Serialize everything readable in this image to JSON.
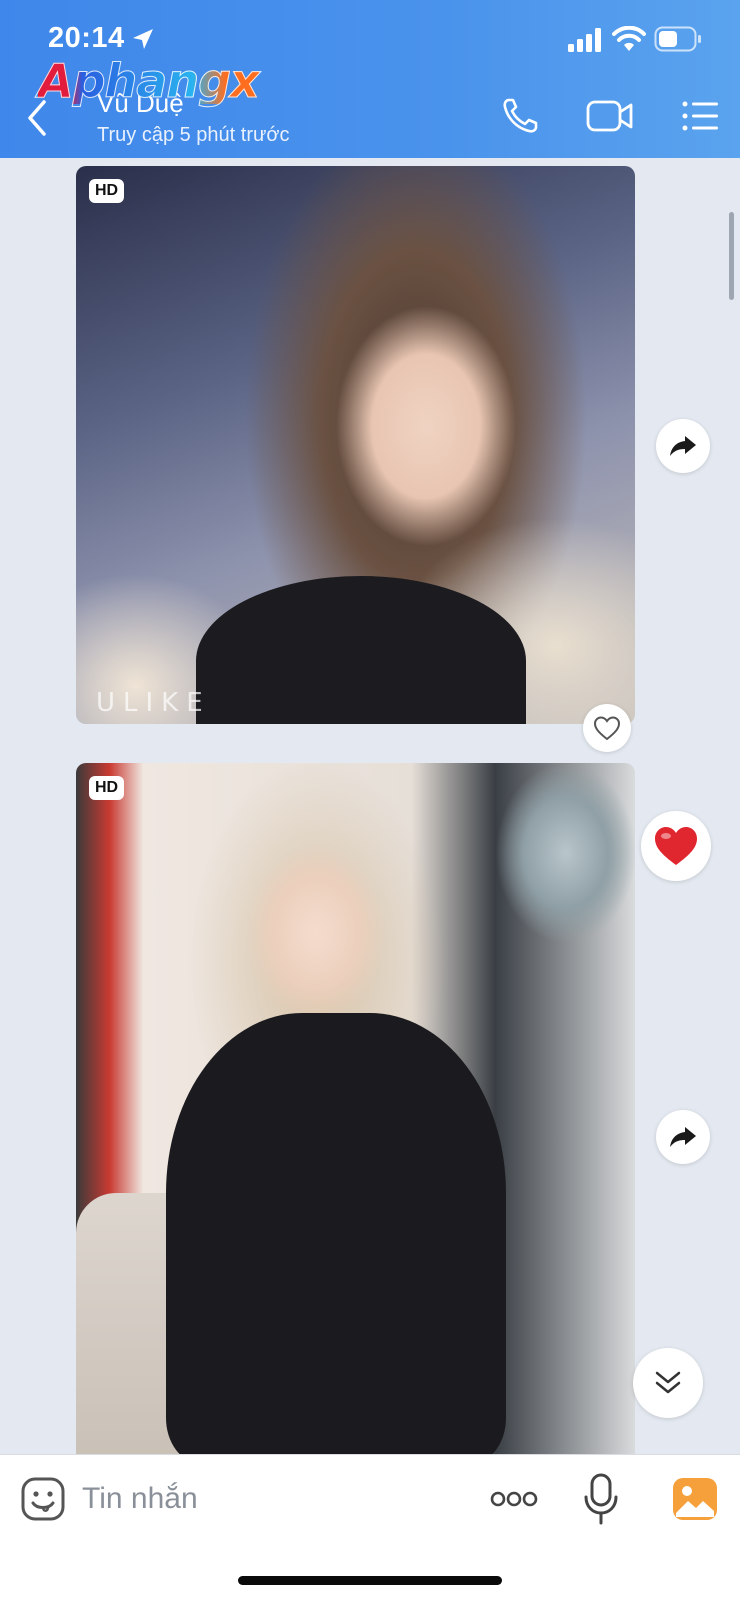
{
  "status_bar": {
    "time": "20:14",
    "icons": [
      "location-arrow-icon",
      "signal-icon",
      "wifi-icon",
      "battery-icon"
    ]
  },
  "watermark_text": "Aphangx",
  "header": {
    "contact_name": "Vũ Duệ",
    "contact_status": "Truy cập 5 phút trước",
    "icons": [
      "back-icon",
      "phone-icon",
      "video-call-icon",
      "menu-list-icon"
    ]
  },
  "messages": [
    {
      "badge": "HD",
      "overlay_text": "ULIKE",
      "reaction": "like-heart-outline"
    },
    {
      "badge": "HD",
      "reaction": "heart-red"
    }
  ],
  "composer": {
    "placeholder": "Tin nhắn",
    "icons": [
      "sticker-icon",
      "more-icon",
      "microphone-icon",
      "gallery-icon"
    ]
  },
  "colors": {
    "header_blue": "#4a93ec",
    "chat_background": "#e4e9f1",
    "heart_red": "#e0262e",
    "gallery_orange": "#f5a03a"
  }
}
